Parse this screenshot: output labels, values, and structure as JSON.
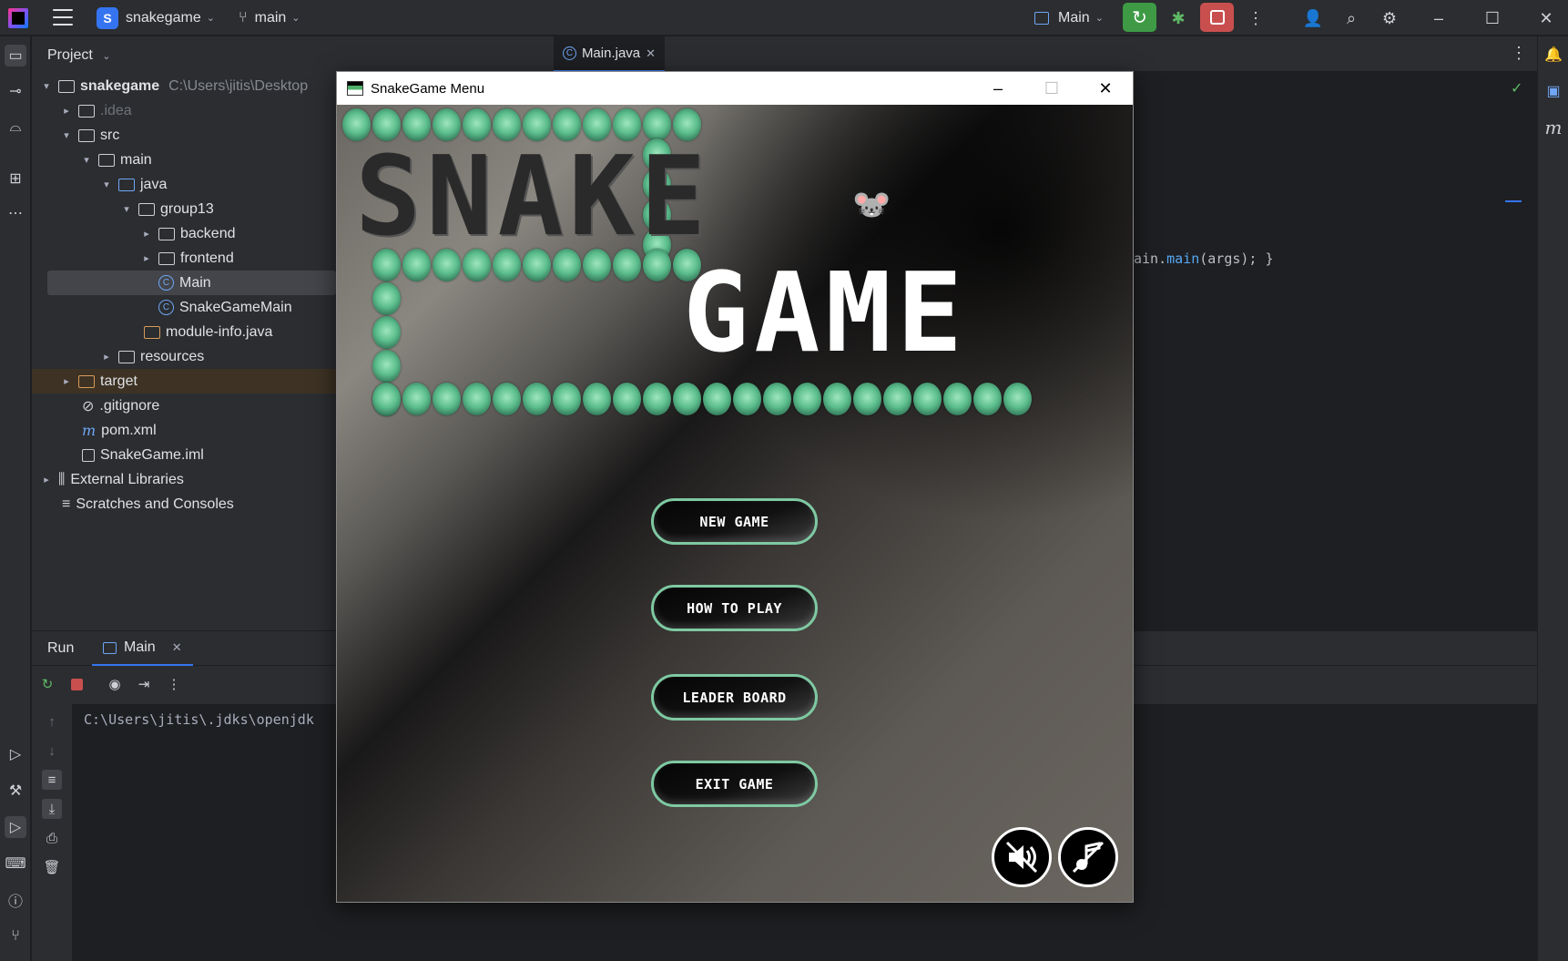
{
  "ide": {
    "project_name": "snakegame",
    "project_badge": "S",
    "branch": "main",
    "run_config": "Main",
    "accent": "#3574f0"
  },
  "project_panel": {
    "title": "Project",
    "root_name": "snakegame",
    "root_path": "C:\\Users\\jitis\\Desktop",
    "items": [
      {
        "label": ".idea"
      },
      {
        "label": "src"
      },
      {
        "label": "main"
      },
      {
        "label": "java"
      },
      {
        "label": "group13"
      },
      {
        "label": "backend"
      },
      {
        "label": "frontend"
      },
      {
        "label": "Main"
      },
      {
        "label": "SnakeGameMain"
      },
      {
        "label": "module-info.java"
      },
      {
        "label": "resources"
      },
      {
        "label": "target"
      },
      {
        "label": ".gitignore"
      },
      {
        "label": "pom.xml"
      },
      {
        "label": "SnakeGame.iml"
      },
      {
        "label": "External Libraries"
      },
      {
        "label": "Scratches and Consoles"
      }
    ]
  },
  "editor": {
    "tab_label": "Main.java",
    "code_fragment_prefix": "ain.",
    "code_fragment_fn": "main",
    "code_fragment_rest": "(args); }"
  },
  "run_panel": {
    "run_tab": "Run",
    "main_tab": "Main",
    "console_line": "C:\\Users\\jitis\\.jdks\\openjdk"
  },
  "game_window": {
    "title": "SnakeGame Menu",
    "title_line1": "SNAKE",
    "title_line2": "GAME",
    "buttons": {
      "new_game": "NEW GAME",
      "how_to_play": "HOW TO PLAY",
      "leader_board": "LEADER BOARD",
      "exit_game": "EXIT GAME"
    },
    "sound_icon": "mute-sound-icon",
    "music_icon": "mute-music-icon",
    "bead_color": "#5bbd8c"
  }
}
